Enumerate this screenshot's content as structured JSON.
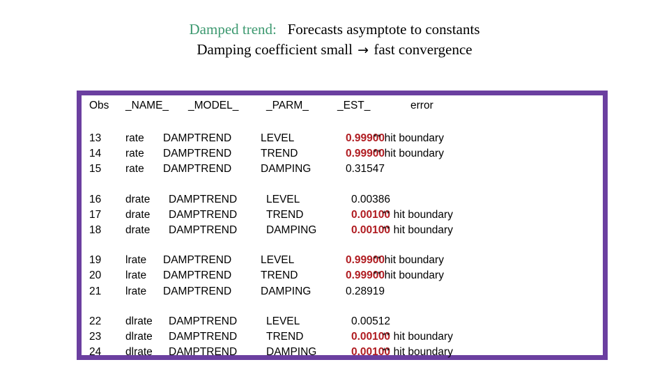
{
  "title": {
    "line1_emphasis": "Damped trend:",
    "line1_rest": "Forecasts asymptote to constants",
    "line2_before_arrow": "Damping coefficient small",
    "line2_arrow": "→",
    "line2_after_arrow": "fast convergence",
    "emphasis_color": "#3d9970"
  },
  "frame": {
    "border_color": "#6b3fa0"
  },
  "table": {
    "columns": [
      "Obs",
      "_NAME_",
      "_MODEL_",
      "_PARM_",
      "_EST_",
      "error"
    ],
    "value_colors": {
      "hit_boundary": "#b01c21",
      "normal": "#000000"
    },
    "note_text": "hit boundary",
    "note_marker": "**",
    "blocks": [
      {
        "name": "rate",
        "indent": 0,
        "rows": [
          {
            "obs": "13",
            "name": "rate",
            "model": "DAMPTREND",
            "parm": "LEVEL",
            "est": "0.99900",
            "est_flag": true,
            "error": "hit boundary"
          },
          {
            "obs": "14",
            "name": "rate",
            "model": "DAMPTREND",
            "parm": "TREND",
            "est": "0.99900",
            "est_flag": true,
            "error": "hit boundary"
          },
          {
            "obs": "15",
            "name": "rate",
            "model": "DAMPTREND",
            "parm": "DAMPING",
            "est": "0.31547",
            "est_flag": false,
            "error": ""
          }
        ]
      },
      {
        "name": "drate",
        "indent": 1,
        "rows": [
          {
            "obs": "16",
            "name": "drate",
            "model": "DAMPTREND",
            "parm": "LEVEL",
            "est": "0.00386",
            "est_flag": false,
            "error": ""
          },
          {
            "obs": "17",
            "name": "drate",
            "model": "DAMPTREND",
            "parm": "TREND",
            "est": "0.00100",
            "est_flag": true,
            "error": "hit boundary"
          },
          {
            "obs": "18",
            "name": "drate",
            "model": "DAMPTREND",
            "parm": "DAMPING",
            "est": "0.00100",
            "est_flag": true,
            "error": "hit boundary"
          }
        ]
      },
      {
        "name": "lrate",
        "indent": 0,
        "rows": [
          {
            "obs": "19",
            "name": "lrate",
            "model": "DAMPTREND",
            "parm": "LEVEL",
            "est": "0.99900",
            "est_flag": true,
            "error": "hit boundary"
          },
          {
            "obs": "20",
            "name": "lrate",
            "model": "DAMPTREND",
            "parm": "TREND",
            "est": "0.99900",
            "est_flag": true,
            "error": "hit boundary"
          },
          {
            "obs": "21",
            "name": "lrate",
            "model": "DAMPTREND",
            "parm": "DAMPING",
            "est": "0.28919",
            "est_flag": false,
            "error": ""
          }
        ]
      },
      {
        "name": "dlrate",
        "indent": 1,
        "rows": [
          {
            "obs": "22",
            "name": "dlrate",
            "model": "DAMPTREND",
            "parm": "LEVEL",
            "est": "0.00512",
            "est_flag": false,
            "error": ""
          },
          {
            "obs": "23",
            "name": "dlrate",
            "model": "DAMPTREND",
            "parm": "TREND",
            "est": "0.00100",
            "est_flag": true,
            "error": "hit boundary"
          },
          {
            "obs": "24",
            "name": "dlrate",
            "model": "DAMPTREND",
            "parm": "DAMPING",
            "est": "0.00100",
            "est_flag": true,
            "error": "hit boundary"
          }
        ]
      }
    ]
  }
}
